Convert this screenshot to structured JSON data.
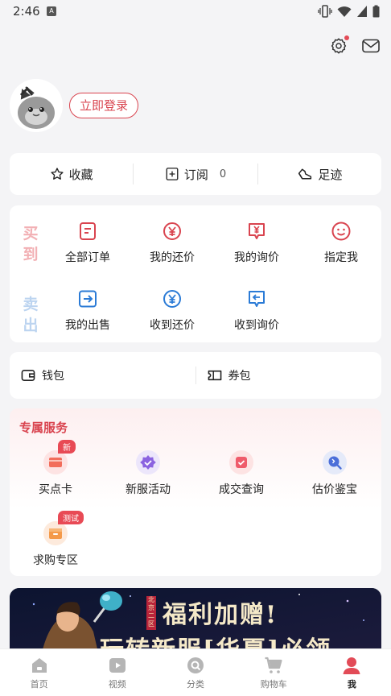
{
  "status_bar": {
    "time": "2:46",
    "notif_letter": "A"
  },
  "header": {
    "login_label": "立即登录"
  },
  "quick": {
    "favorites": "收藏",
    "subscribe": "订阅",
    "subscribe_count": "0",
    "footprint": "足迹"
  },
  "trade": {
    "buy_side": [
      "买",
      "到"
    ],
    "sell_side": [
      "卖",
      "出"
    ],
    "buy_items": [
      "全部订单",
      "我的还价",
      "我的询价",
      "指定我"
    ],
    "sell_items": [
      "我的出售",
      "收到还价",
      "收到询价"
    ]
  },
  "wallet": {
    "wallet": "钱包",
    "coupons": "券包"
  },
  "service": {
    "title": "专属服务",
    "items": [
      {
        "label": "买点卡",
        "badge": "新"
      },
      {
        "label": "新服活动"
      },
      {
        "label": "成交查询"
      },
      {
        "label": "估价鉴宝"
      },
      {
        "label": "求购专区",
        "badge": "测试"
      }
    ]
  },
  "banner": {
    "text_line1": "福利加赠!",
    "text_line2": "玩转新服[华夏]必领",
    "stamp": "北京二区"
  },
  "tabs": [
    {
      "label": "首页",
      "icon": "home-icon"
    },
    {
      "label": "视频",
      "icon": "video-icon"
    },
    {
      "label": "分类",
      "icon": "category-icon"
    },
    {
      "label": "购物车",
      "icon": "cart-icon"
    },
    {
      "label": "我",
      "icon": "profile-icon"
    }
  ],
  "colors": {
    "accent": "#d9444f",
    "sell_blue": "#2b7bd6"
  }
}
